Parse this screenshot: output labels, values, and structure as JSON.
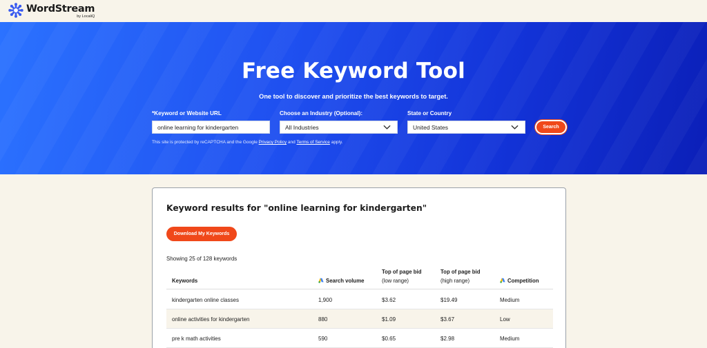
{
  "brand": {
    "name": "WordStream",
    "byline": "by LocaliQ",
    "color": "#3a5bf0"
  },
  "hero": {
    "title": "Free Keyword Tool",
    "subtitle": "One tool to discover and prioritize the best keywords to target.",
    "keyword_label": "*Keyword or Website URL",
    "keyword_value": "online learning for kindergarten",
    "industry_label": "Choose an Industry (Optional):",
    "industry_value": "All Industries",
    "location_label": "State or Country",
    "location_value": "United States",
    "search_label": "Search",
    "recaptcha_prefix": "This site is protected by reCAPTCHA and the Google",
    "privacy_link": "Privacy Policy",
    "and_text": "and",
    "terms_link": "Terms of Service",
    "apply_text": "apply."
  },
  "results": {
    "title": "Keyword results for \"online learning for kindergarten\"",
    "download_label": "Download My Keywords",
    "showing": "Showing 25 of 128 keywords",
    "columns": {
      "keywords": "Keywords",
      "volume": "Search volume",
      "low_bid": "Top of page bid",
      "low_bid_sub": "(low range)",
      "high_bid": "Top of page bid",
      "high_bid_sub": "(high range)",
      "competition": "Competition"
    },
    "rows": [
      {
        "keyword": "kindergarten online classes",
        "volume": "1,900",
        "low": "$3.62",
        "high": "$19.49",
        "competition": "Medium"
      },
      {
        "keyword": "online activities for kindergarten",
        "volume": "880",
        "low": "$1.09",
        "high": "$3.67",
        "competition": "Low"
      },
      {
        "keyword": "pre k math activities",
        "volume": "590",
        "low": "$0.65",
        "high": "$2.98",
        "competition": "Medium"
      }
    ]
  },
  "colors": {
    "accent": "#f0481a",
    "hero_start": "#2b72ff",
    "hero_end": "#0b1fb8",
    "page_bg": "#f8f4ea"
  },
  "icons": {
    "logo": "wordstream-asterisk-icon",
    "dropdown": "chevron-down-icon",
    "ads": "google-ads-icon"
  }
}
